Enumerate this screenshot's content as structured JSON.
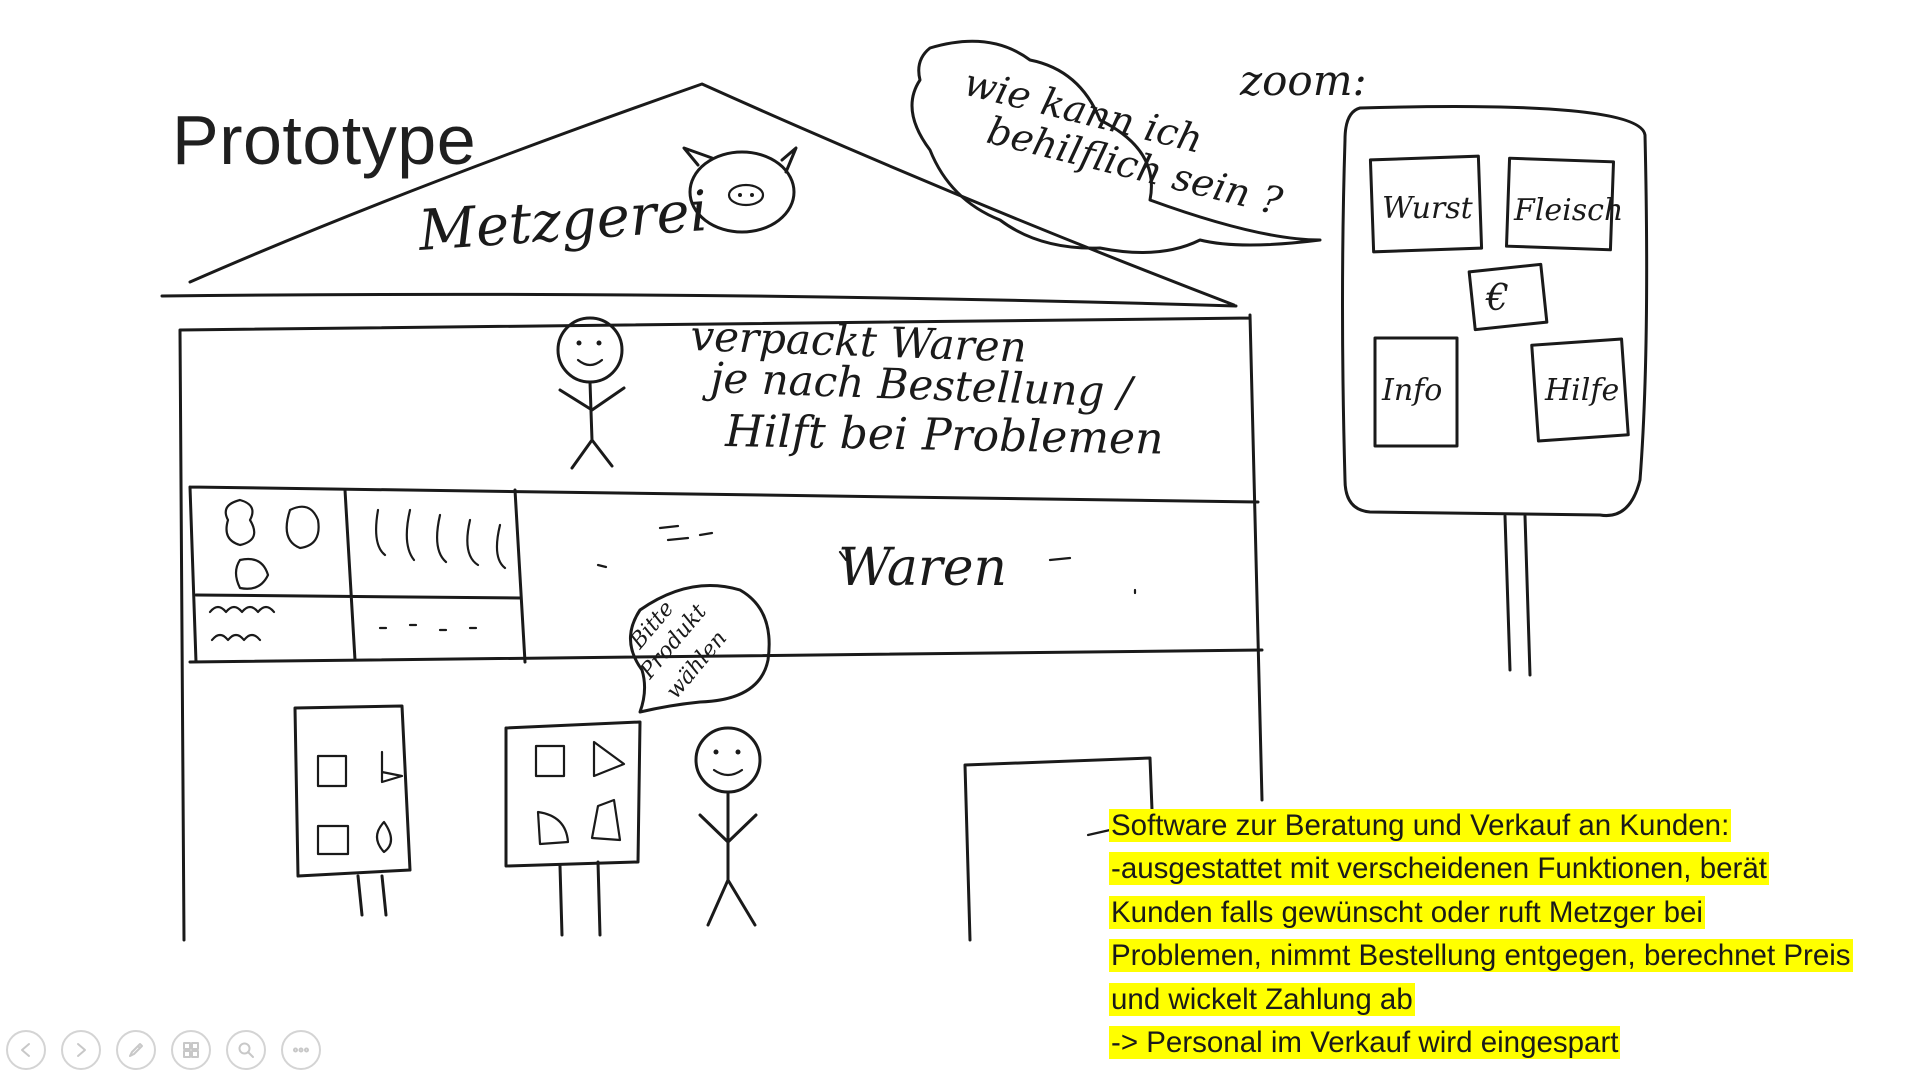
{
  "slide": {
    "title": "Prototype"
  },
  "sketch": {
    "shop_sign": "Metzgerei",
    "speech_bubble_top": [
      "wie kann ich",
      "behilflich sein ?"
    ],
    "zoom_label": "zoom:",
    "kiosk_buttons": [
      "Wurst",
      "Fleisch",
      "€",
      "Info",
      "Hilfe"
    ],
    "staff_text": [
      "verpackt Waren",
      "je nach Bestellung /",
      "Hilft bei Problemen"
    ],
    "goods_label": "Waren",
    "speech_bubble_bottom": [
      "Bitte",
      "Produkt",
      "wählen"
    ]
  },
  "note": {
    "lines": [
      "Software zur Beratung und Verkauf an Kunden:",
      " -ausgestattet mit verscheidenen Funktionen, berät",
      "Kunden falls gewünscht oder ruft Metzger bei",
      "Problemen, nimmt Bestellung entgegen, berechnet Preis",
      "und wickelt Zahlung ab",
      "-> Personal im Verkauf wird eingespart"
    ],
    "highlight_color": "#ffff00"
  },
  "toolbar": {
    "buttons": [
      {
        "icon": "previous-slide-icon"
      },
      {
        "icon": "next-slide-icon"
      },
      {
        "icon": "pen-icon"
      },
      {
        "icon": "slide-overview-icon"
      },
      {
        "icon": "zoom-icon"
      },
      {
        "icon": "more-options-icon"
      }
    ]
  }
}
